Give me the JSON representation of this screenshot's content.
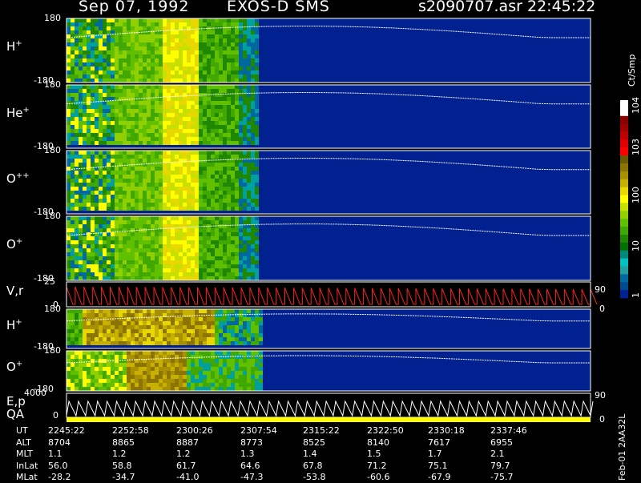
{
  "header": {
    "date": "Sep 07, 1992",
    "instrument": "EXOS-D SMS",
    "file": "s2090707.asr",
    "time": "22:45:22"
  },
  "colors": {
    "background": "#000000",
    "empty": "#00218f",
    "trace": "#ffffff",
    "velocity_trace": "#ff2020"
  },
  "chart_data": {
    "type": "heatmap",
    "title": "Sep 07, 1992   EXOS-D SMS",
    "panels": [
      {
        "label": "H",
        "superscript": "+",
        "ytop": "180",
        "ybot": "-180",
        "ylim": [
          -180,
          180
        ]
      },
      {
        "label": "He",
        "superscript": "+",
        "ytop": "180",
        "ybot": "-180",
        "ylim": [
          -180,
          180
        ]
      },
      {
        "label": "O",
        "superscript": "++",
        "ytop": "180",
        "ybot": "-180",
        "ylim": [
          -180,
          180
        ]
      },
      {
        "label": "O",
        "superscript": "+",
        "ytop": "180",
        "ybot": "-180",
        "ylim": [
          -180,
          180
        ]
      },
      {
        "label": "V,r",
        "superscript": "",
        "ytop": "25",
        "ybot": "0",
        "right_top": "90",
        "right_bot": "0"
      },
      {
        "label": "H",
        "superscript": "+",
        "ytop": "180",
        "ybot": "-180",
        "ylim": [
          -180,
          180
        ]
      },
      {
        "label": "O",
        "superscript": "+",
        "ytop": "180",
        "ybot": "-180",
        "ylim": [
          -180,
          180
        ]
      },
      {
        "label": "E,p",
        "superscript": "",
        "ytop": "4000",
        "ybot": "0",
        "right_top": "90",
        "right_bot": "0"
      }
    ],
    "qa_label": "QA",
    "colorbar": {
      "unit": "Ct/Smp",
      "ticks": [
        "10^4",
        "10^3",
        "100",
        "10",
        "1"
      ],
      "scale": "log",
      "colors": [
        "#ffffff",
        "#ffffff",
        "#8b0000",
        "#a00000",
        "#c00000",
        "#e00000",
        "#ff0000",
        "#6b5a00",
        "#8b7500",
        "#a89000",
        "#c8b000",
        "#e8d800",
        "#ffff00",
        "#c8e000",
        "#90d000",
        "#60c000",
        "#40a800",
        "#208800",
        "#007000",
        "#008878",
        "#00c0c0",
        "#20a0a0",
        "#006aa0",
        "#004a90",
        "#00218f"
      ]
    },
    "ephemeris": {
      "labels": [
        "UT",
        "ALT",
        "MLT",
        "InLat",
        "MLat"
      ],
      "UT": [
        "2245:22",
        "2252:58",
        "2300:26",
        "2307:54",
        "2315:22",
        "2322:50",
        "2330:18",
        "2337:46"
      ],
      "ALT": [
        "8704",
        "8865",
        "8887",
        "8773",
        "8525",
        "8140",
        "7617",
        "6955"
      ],
      "MLT": [
        "1.1",
        "1.2",
        "1.2",
        "1.3",
        "1.4",
        "1.5",
        "1.7",
        "2.1"
      ],
      "InLat": [
        "56.0",
        "58.8",
        "61.7",
        "64.6",
        "67.8",
        "71.2",
        "75.1",
        "79.7"
      ],
      "MLat": [
        "-28.2",
        "-34.7",
        "-41.0",
        "-47.3",
        "-53.8",
        "-60.6",
        "-67.9",
        "-75.7"
      ]
    },
    "footer": "Feb-01 2AA32L"
  }
}
